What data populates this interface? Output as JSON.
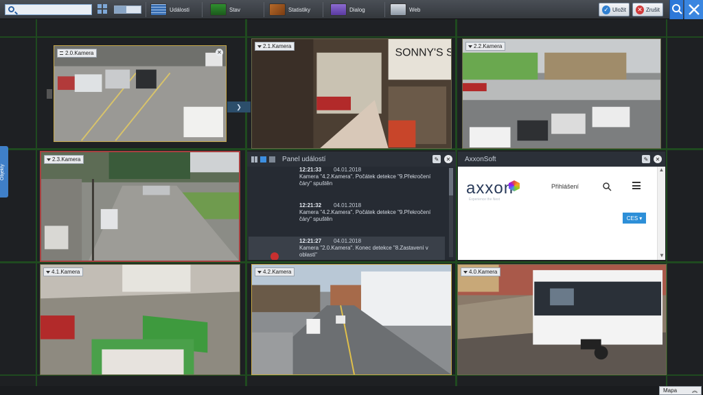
{
  "toolbar": {
    "search_value": "",
    "buttons": [
      {
        "label": "Události",
        "icon": "events-grid-icon"
      },
      {
        "label": "Stav",
        "icon": "status-icon"
      },
      {
        "label": "Statistiky",
        "icon": "statistics-icon"
      },
      {
        "label": "Dialog",
        "icon": "dialog-icon"
      },
      {
        "label": "Web",
        "icon": "web-icon"
      }
    ],
    "save_label": "Uložit",
    "cancel_label": "Zrušit"
  },
  "sidebar_tab": "Objekty",
  "cameras": {
    "c20": "2.0.Kamera",
    "c21": "2.1.Kamera",
    "c22": "2.2.Kamera",
    "c23": "2.3.Kamera",
    "c41": "4.1.Kamera",
    "c42": "4.2.Kamera",
    "c40": "4.0.Kamera"
  },
  "events_panel": {
    "title": "Panel událostí",
    "events": [
      {
        "time": "12:21:33",
        "date": "04.01.2018",
        "text1": "Kamera \"4.2.Kamera\". Počátek detekce \"9.Překročení",
        "text2": "čáry\" spuštěn"
      },
      {
        "time": "12:21:32",
        "date": "04.01.2018",
        "text1": "Kamera \"4.2.Kamera\". Počátek detekce \"9.Překročení",
        "text2": "čáry\" spuštěn"
      },
      {
        "time": "12:21:27",
        "date": "04.01.2018",
        "text1": "Kamera \"2.0.Kamera\". Konec detekce \"8.Zastavení v",
        "text2": "oblasti\""
      }
    ]
  },
  "browser_panel": {
    "title": "AxxonSoft",
    "logo_text": "axxon",
    "tagline": "Experience the Next",
    "login": "Přihlášení",
    "lang": "CES"
  },
  "map_bar": {
    "label": "Mapa"
  },
  "colors": {
    "active_border": "#c8a848",
    "alarm_border": "#a84040",
    "grid_line": "#1f4a1f",
    "accent": "#2d78d8"
  }
}
